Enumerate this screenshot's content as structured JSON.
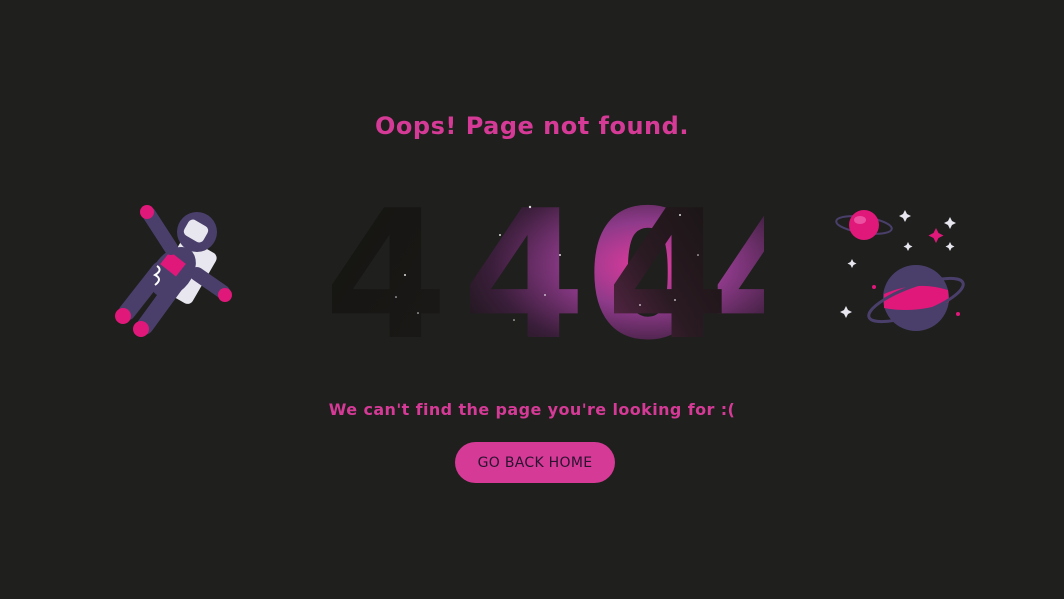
{
  "page": {
    "title": "Oops! Page not found.",
    "error_code": "404",
    "message": "We can't find the page you're looking for :(",
    "button_label": "GO BACK HOME"
  },
  "colors": {
    "background": "#1f1f1d",
    "accent": "#d43a96",
    "button_text": "#2a1330"
  },
  "illustrations": {
    "left": "astronaut-icon",
    "right": "planets-icon"
  }
}
